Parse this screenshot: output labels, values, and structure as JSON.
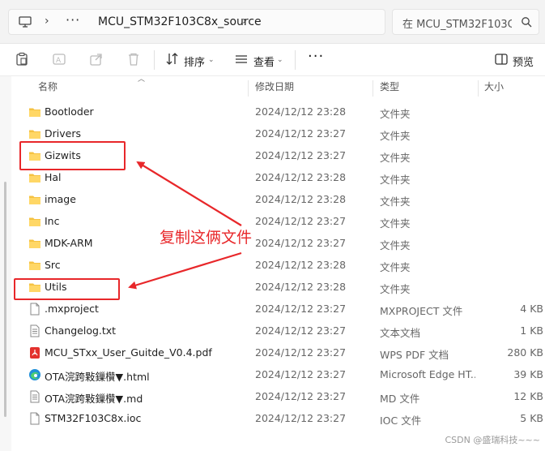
{
  "address_bar": {
    "crumb_overflow": "···",
    "current_folder": "MCU_STM32F103C8x_source",
    "pc_icon": "computer-icon",
    "separator_icon": "chevron-right-icon"
  },
  "search": {
    "placeholder": "在 MCU_STM32F103C",
    "icon": "search-icon"
  },
  "toolbar": {
    "sort_label": "排序",
    "view_label": "查看",
    "more_label": "···",
    "preview_label": "预览"
  },
  "columns": {
    "name": "名称",
    "modified": "修改日期",
    "type": "类型",
    "size": "大小"
  },
  "files": [
    {
      "name": "Bootloder",
      "modified": "2024/12/12 23:28",
      "type": "文件夹",
      "size": "",
      "icon": "folder-icon"
    },
    {
      "name": "Drivers",
      "modified": "2024/12/12 23:27",
      "type": "文件夹",
      "size": "",
      "icon": "folder-icon"
    },
    {
      "name": "Gizwits",
      "modified": "2024/12/12 23:27",
      "type": "文件夹",
      "size": "",
      "icon": "folder-icon"
    },
    {
      "name": "Hal",
      "modified": "2024/12/12 23:28",
      "type": "文件夹",
      "size": "",
      "icon": "folder-icon"
    },
    {
      "name": "image",
      "modified": "2024/12/12 23:28",
      "type": "文件夹",
      "size": "",
      "icon": "folder-icon"
    },
    {
      "name": "Inc",
      "modified": "2024/12/12 23:27",
      "type": "文件夹",
      "size": "",
      "icon": "folder-icon"
    },
    {
      "name": "MDK-ARM",
      "modified": "2024/12/12 23:27",
      "type": "文件夹",
      "size": "",
      "icon": "folder-icon"
    },
    {
      "name": "Src",
      "modified": "2024/12/12 23:28",
      "type": "文件夹",
      "size": "",
      "icon": "folder-icon"
    },
    {
      "name": "Utils",
      "modified": "2024/12/12 23:28",
      "type": "文件夹",
      "size": "",
      "icon": "folder-icon"
    },
    {
      "name": ".mxproject",
      "modified": "2024/12/12 23:27",
      "type": "MXPROJECT 文件",
      "size": "4 KB",
      "icon": "file-icon"
    },
    {
      "name": "Changelog.txt",
      "modified": "2024/12/12 23:27",
      "type": "文本文档",
      "size": "1 KB",
      "icon": "text-file-icon"
    },
    {
      "name": "MCU_STxx_User_Guitde_V0.4.pdf",
      "modified": "2024/12/12 23:27",
      "type": "WPS PDF 文档",
      "size": "280 KB",
      "icon": "pdf-icon"
    },
    {
      "name": "OTA浣跨敤鏁欑▼.html",
      "modified": "2024/12/12 23:27",
      "type": "Microsoft Edge HT...",
      "size": "39 KB",
      "icon": "edge-icon"
    },
    {
      "name": "OTA浣跨敤鏁欑▼.md",
      "modified": "2024/12/12 23:27",
      "type": "MD 文件",
      "size": "12 KB",
      "icon": "text-file-icon"
    },
    {
      "name": "STM32F103C8x.ioc",
      "modified": "2024/12/12 23:27",
      "type": "IOC 文件",
      "size": "5 KB",
      "icon": "file-icon"
    }
  ],
  "annotation": {
    "text": "复制这俩文件",
    "color": "#e8272a"
  },
  "watermark": "CSDN @盛瑞科技~~~"
}
